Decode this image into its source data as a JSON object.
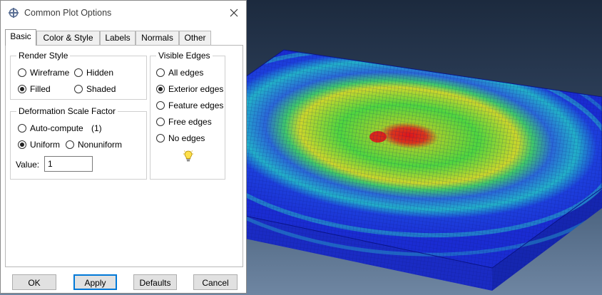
{
  "dialog": {
    "title": "Common Plot Options",
    "tabs": [
      {
        "label": "Basic",
        "active": true
      },
      {
        "label": "Color & Style",
        "active": false
      },
      {
        "label": "Labels",
        "active": false
      },
      {
        "label": "Normals",
        "active": false
      },
      {
        "label": "Other",
        "active": false
      }
    ],
    "render_style": {
      "title": "Render Style",
      "options": [
        {
          "label": "Wireframe",
          "selected": false
        },
        {
          "label": "Hidden",
          "selected": false
        },
        {
          "label": "Filled",
          "selected": true
        },
        {
          "label": "Shaded",
          "selected": false
        }
      ]
    },
    "deformation": {
      "title": "Deformation Scale Factor",
      "auto_label": "Auto-compute",
      "auto_value": "(1)",
      "auto_selected": false,
      "uniform_label": "Uniform",
      "uniform_selected": true,
      "nonuniform_label": "Nonuniform",
      "nonuniform_selected": false,
      "value_label": "Value:",
      "value": "1"
    },
    "visible_edges": {
      "title": "Visible Edges",
      "options": [
        {
          "label": "All edges",
          "selected": false
        },
        {
          "label": "Exterior edges",
          "selected": true
        },
        {
          "label": "Feature edges",
          "selected": false
        },
        {
          "label": "Free edges",
          "selected": false
        },
        {
          "label": "No edges",
          "selected": false
        }
      ],
      "hint_icon": "lightbulb-icon"
    },
    "buttons": {
      "ok": "OK",
      "apply": "Apply",
      "defaults": "Defaults",
      "cancel": "Cancel"
    }
  },
  "viewport": {
    "background_top": "#1c2a3e",
    "background_bottom": "#6f86a2",
    "mesh_colors": [
      "#1a2fd8",
      "#23b4c0",
      "#3fd24a",
      "#c8d22a",
      "#e0151a"
    ]
  }
}
